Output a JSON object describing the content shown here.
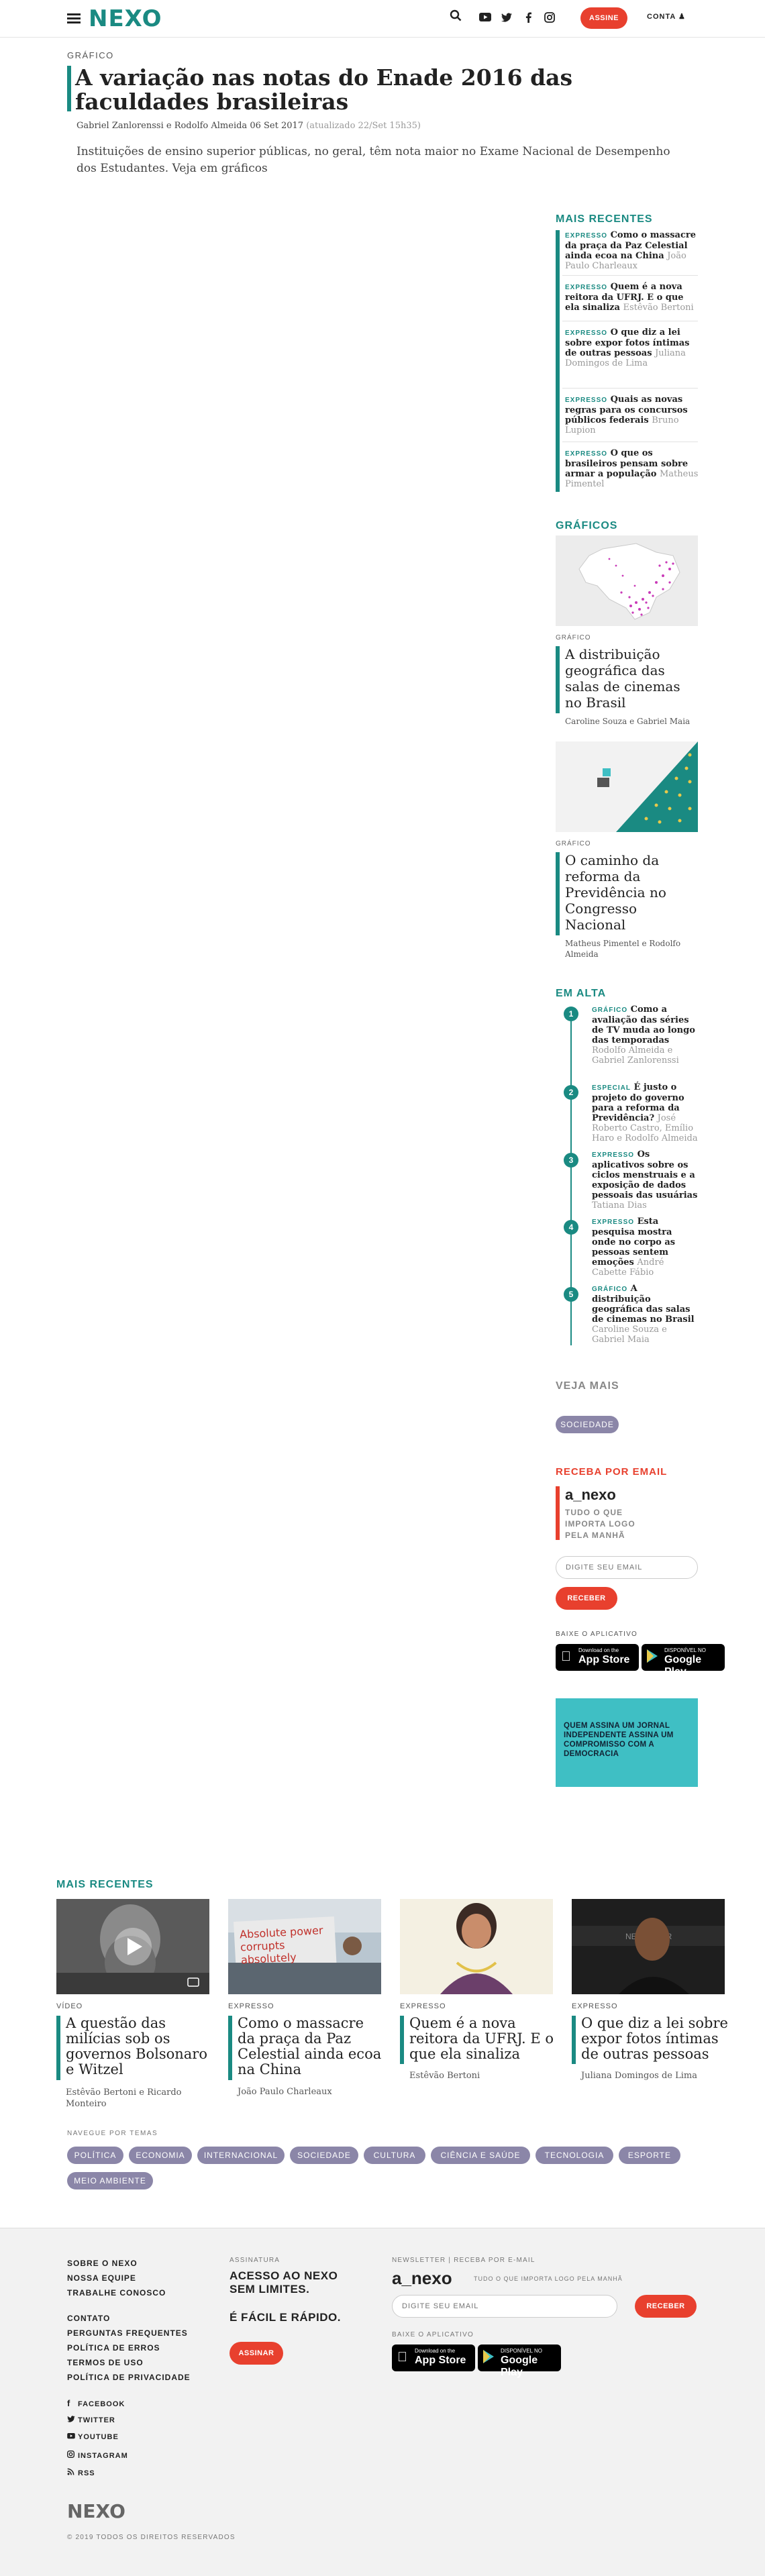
{
  "header": {
    "logo": "NEXO",
    "subscribe": "ASSINE",
    "account": "CONTA"
  },
  "article": {
    "kicker": "GRÁFICO",
    "title": "A variação nas notas do Enade 2016 das faculdades brasileiras",
    "byline": "Gabriel Zanlorenssi e Rodolfo Almeida",
    "date": "06 Set 2017",
    "updated": "(atualizado 22/Set 15h35)",
    "lead": "Instituições de ensino superior públicas, no geral, têm nota maior no Exame Nacional de Desempenho dos Estudantes. Veja em gráficos"
  },
  "sidebar": {
    "recent_label": "MAIS RECENTES",
    "recent": [
      {
        "tag": "EXPRESSO",
        "title": "Como o massacre da praça da Paz Celestial ainda ecoa na China",
        "author": "João Paulo Charleaux"
      },
      {
        "tag": "EXPRESSO",
        "title": "Quem é a nova reitora da UFRJ. E o que ela sinaliza",
        "author": "Estêvão Bertoni"
      },
      {
        "tag": "EXPRESSO",
        "title": "O que diz a lei sobre expor fotos íntimas de outras pessoas",
        "author": "Juliana Domingos de Lima"
      },
      {
        "tag": "EXPRESSO",
        "title": "Quais as novas regras para os concursos públicos federais",
        "author": "Bruno Lupion"
      },
      {
        "tag": "EXPRESSO",
        "title": "O que os brasileiros pensam sobre armar a população",
        "author": "Matheus Pimentel"
      }
    ],
    "graphics_label": "GRÁFICOS",
    "graphics": [
      {
        "kicker": "GRÁFICO",
        "title": "A distribuição geográfica das salas de cinemas no Brasil",
        "author": "Caroline Souza e Gabriel Maia"
      },
      {
        "kicker": "GRÁFICO",
        "title": "O caminho da reforma da Previdência no Congresso Nacional",
        "author": "Matheus Pimentel e Rodolfo Almeida"
      }
    ],
    "trending_label": "EM ALTA",
    "trending": [
      {
        "rank": "1",
        "tag": "GRÁFICO",
        "title": "Como a avaliação das séries de TV muda ao longo das temporadas",
        "author": "Rodolfo Almeida e Gabriel Zanlorenssi"
      },
      {
        "rank": "2",
        "tag": "ESPECIAL",
        "title": "É justo o projeto do governo para a reforma da Previdência?",
        "author": "José Roberto Castro, Emílio Haro e Rodolfo Almeida"
      },
      {
        "rank": "3",
        "tag": "EXPRESSO",
        "title": "Os aplicativos sobre os ciclos menstruais e a exposição de dados pessoais das usuárias",
        "author": "Tatiana Dias"
      },
      {
        "rank": "4",
        "tag": "EXPRESSO",
        "title": "Esta pesquisa mostra onde no corpo as pessoas sentem emoções",
        "author": "André Cabette Fábio"
      },
      {
        "rank": "5",
        "tag": "GRÁFICO",
        "title": "A distribuição geográfica das salas de cinemas no Brasil",
        "author": "Caroline Souza e Gabriel Maia"
      }
    ],
    "more_label": "VEJA MAIS",
    "more_chip": "SOCIEDADE",
    "email_label": "RECEBA POR EMAIL",
    "email_brand": "a_nexo",
    "email_tagline": "TUDO O QUE IMPORTA LOGO PELA MANHÃ",
    "email_placeholder": "DIGITE SEU EMAIL",
    "email_button": "RECEBER",
    "app_label": "BAIXE O APLICATIVO",
    "appstore_small": "Download on the",
    "appstore_big": "App Store",
    "play_small": "DISPONÍVEL NO",
    "play_big": "Google Play",
    "promo": "QUEM ASSINA UM JORNAL INDEPENDENTE ASSINA UM COMPROMISSO COM A DEMOCRACIA"
  },
  "recent_bottom": {
    "label": "MAIS RECENTES",
    "cards": [
      {
        "kicker": "VÍDEO",
        "title": "A questão das milícias sob os governos Bolsonaro e Witzel",
        "author": "Estêvão Bertoni e Ricardo Monteiro"
      },
      {
        "kicker": "EXPRESSO",
        "title": "Como o massacre da praça da Paz Celestial ainda ecoa na China",
        "author": "João Paulo Charleaux"
      },
      {
        "kicker": "EXPRESSO",
        "title": "Quem é a nova reitora da UFRJ. E o que ela sinaliza",
        "author": "Estêvão Bertoni"
      },
      {
        "kicker": "EXPRESSO",
        "title": "O que diz a lei sobre expor fotos íntimas de outras pessoas",
        "author": "Juliana Domingos de Lima"
      }
    ],
    "sign_text": "Absolute power corrupts absolutely"
  },
  "topics": {
    "label": "NAVEGUE POR TEMAS",
    "chips": [
      "POLÍTICA",
      "ECONOMIA",
      "INTERNACIONAL",
      "SOCIEDADE",
      "CULTURA",
      "CIÊNCIA E SAÚDE",
      "TECNOLOGIA",
      "ESPORTE",
      "MEIO AMBIENTE"
    ]
  },
  "footer": {
    "links1": [
      "SOBRE O NEXO",
      "NOSSA EQUIPE",
      "TRABALHE CONOSCO"
    ],
    "links2": [
      "CONTATO",
      "PERGUNTAS FREQUENTES",
      "POLÍTICA DE ERROS",
      "TERMOS DE USO",
      "POLÍTICA DE PRIVACIDADE"
    ],
    "social": [
      "FACEBOOK",
      "TWITTER",
      "YOUTUBE",
      "INSTAGRAM",
      "RSS"
    ],
    "sub_label": "ASSINATURA",
    "sub_line1": "ACESSO AO NEXO SEM LIMITES.",
    "sub_line2": "É FÁCIL E RÁPIDO.",
    "sub_button": "ASSINAR",
    "news_label": "NEWSLETTER | RECEBA POR E-MAIL",
    "news_brand": "a_nexo",
    "news_tagline": "TUDO O QUE IMPORTA LOGO PELA MANHÃ",
    "news_placeholder": "DIGITE SEU EMAIL",
    "news_button": "RECEBER",
    "app_label": "BAIXE O APLICATIVO",
    "logo": "NEXO",
    "copyright": "© 2019 TODOS OS DIREITOS RESERVADOS"
  },
  "colors": {
    "brand": "#1a8a82",
    "accent": "#e8402e",
    "chip": "#8b86a8",
    "promo": "#3fbfc4"
  }
}
